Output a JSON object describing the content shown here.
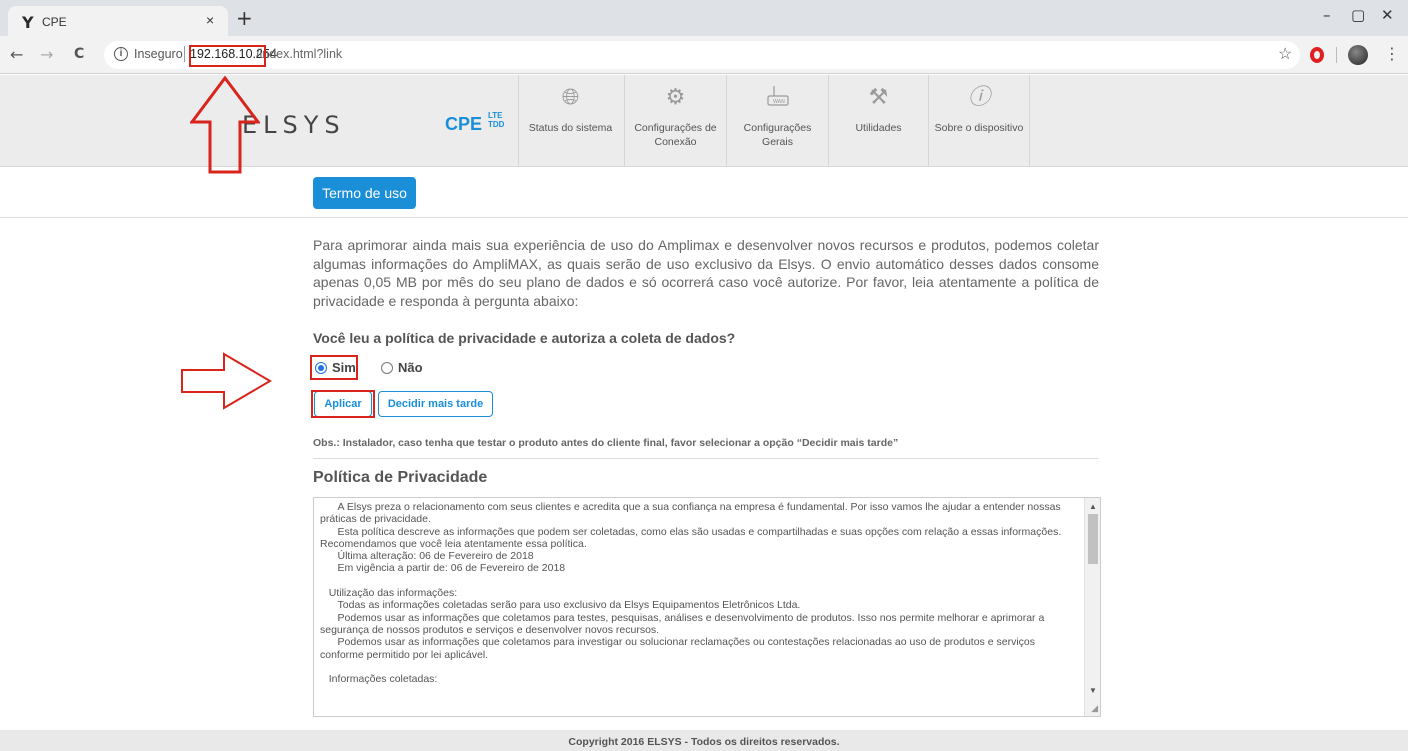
{
  "browser": {
    "tab_title": "CPE",
    "tab_favicon": "Y",
    "tab_close": "×",
    "new_tab": "+",
    "win_min": "–",
    "win_max": "▢",
    "win_close": "✕",
    "nav_back": "←",
    "nav_forward": "→",
    "nav_reload": "C",
    "security_label": "Inseguro",
    "url_host": "192.168.10.254",
    "url_path": "/index.html?link",
    "bookmark_icon": "☆",
    "menu_icon": "⋮"
  },
  "header": {
    "logo": "ELSYS",
    "product_logo": "CPE",
    "product_sub_1": "LTE",
    "product_sub_2": "TDD",
    "nav": [
      {
        "label": "Status do sistema",
        "icon": "globe-icon"
      },
      {
        "label": "Configurações de Conexão",
        "icon": "gear-icon"
      },
      {
        "label": "Configurações Gerais",
        "icon": "router-icon"
      },
      {
        "label": "Utilidades",
        "icon": "tools-icon"
      },
      {
        "label": "Sobre o dispositivo",
        "icon": "info-icon"
      }
    ]
  },
  "content": {
    "term_button": "Termo de uso",
    "intro": "Para aprimorar ainda mais sua experiência de uso do Amplimax e desenvolver novos recursos e produtos, podemos coletar algumas informações do AmpliMAX, as quais serão de uso exclusivo da Elsys. O envio automático desses dados consome apenas 0,05 MB por mês do seu plano de dados e só ocorrerá caso você autorize. Por favor, leia atentamente a política de privacidade e responda à pergunta abaixo:",
    "question": "Você leu a política de privacidade e autoriza a coleta de dados?",
    "option_yes": "Sim",
    "option_no": "Não",
    "selected": "Sim",
    "apply_button": "Aplicar",
    "later_button": "Decidir mais tarde",
    "obs": "Obs.: Instalador, caso tenha que testar o produto antes do cliente final, favor selecionar a opção “Decidir mais tarde”",
    "policy_title": "Política de Privacidade",
    "policy_text": "      A Elsys preza o relacionamento com seus clientes e acredita que a sua confiança na empresa é fundamental. Por isso vamos lhe ajudar a entender nossas\npráticas de privacidade.\n      Esta política descreve as informações que podem ser coletadas, como elas são usadas e compartilhadas e suas opções com relação a essas informações.\nRecomendamos que você leia atentamente essa política.\n      Última alteração: 06 de Fevereiro de 2018\n      Em vigência a partir de: 06 de Fevereiro de 2018\n\n   Utilização das informações:\n      Todas as informações coletadas serão para uso exclusivo da Elsys Equipamentos Eletrônicos Ltda.\n      Podemos usar as informações que coletamos para testes, pesquisas, análises e desenvolvimento de produtos. Isso nos permite melhorar e aprimorar a\nsegurança de nossos produtos e serviços e desenvolver novos recursos.\n      Podemos usar as informações que coletamos para investigar ou solucionar reclamações ou contestações relacionadas ao uso de produtos e serviços\nconforme permitido por lei aplicável.\n\n   Informações coletadas:"
  },
  "footer": {
    "copyright": "Copyright 2016 ELSYS - Todos os direitos reservados."
  },
  "colors": {
    "accent": "#1a8fd8",
    "highlight_red": "#d9241b"
  }
}
